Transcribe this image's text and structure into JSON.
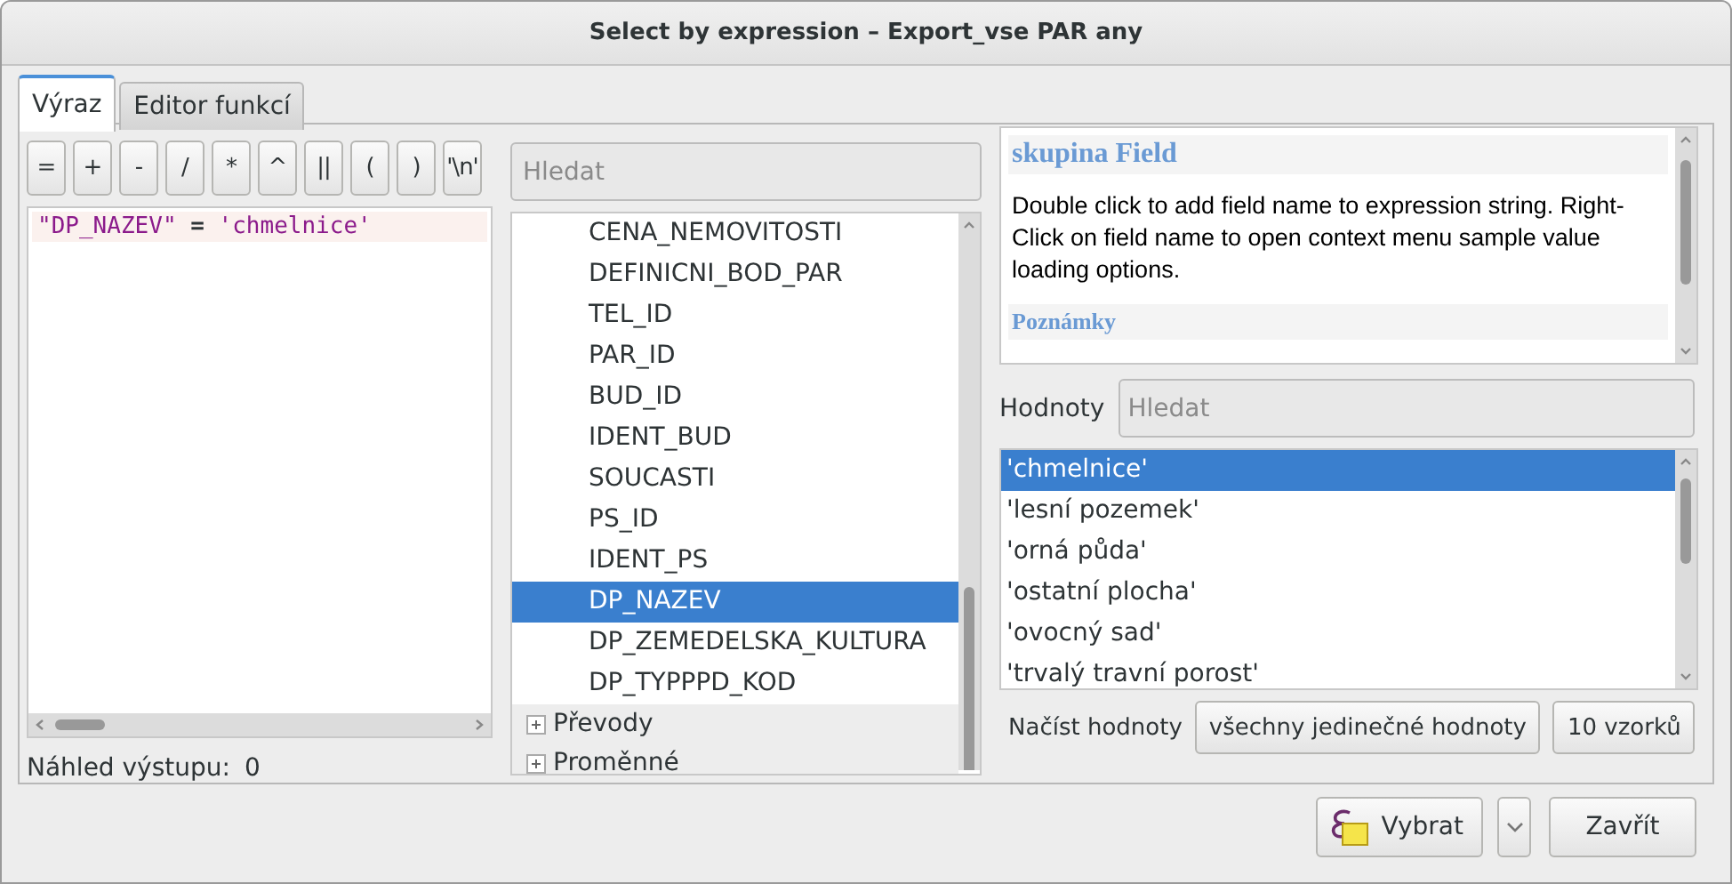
{
  "window": {
    "title": "Select by expression – Export_vse PAR any"
  },
  "tabs": [
    {
      "label": "Výraz",
      "selected": true
    },
    {
      "label": "Editor funkcí",
      "selected": false
    }
  ],
  "operators": [
    "=",
    "+",
    "-",
    "/",
    "*",
    "^",
    "||",
    "(",
    ")",
    "'\\n'"
  ],
  "expression": {
    "field": "\"DP_NAZEV\"",
    "operator": "=",
    "value": "'chmelnice'"
  },
  "output_preview": {
    "label": "Náhled výstupu:",
    "value": "0"
  },
  "tree": {
    "search_placeholder": "Hledat",
    "fields": [
      {
        "label": "CENA_NEMOVITOSTI",
        "selected": false
      },
      {
        "label": "DEFINICNI_BOD_PAR",
        "selected": false
      },
      {
        "label": "TEL_ID",
        "selected": false
      },
      {
        "label": "PAR_ID",
        "selected": false
      },
      {
        "label": "BUD_ID",
        "selected": false
      },
      {
        "label": "IDENT_BUD",
        "selected": false
      },
      {
        "label": "SOUCASTI",
        "selected": false
      },
      {
        "label": "PS_ID",
        "selected": false
      },
      {
        "label": "IDENT_PS",
        "selected": false
      },
      {
        "label": "DP_NAZEV",
        "selected": true
      },
      {
        "label": "DP_ZEMEDELSKA_KULTURA",
        "selected": false
      },
      {
        "label": "DP_TYPPPD_KOD",
        "selected": false
      }
    ],
    "groups": [
      {
        "label": "Převody",
        "expanded": false
      },
      {
        "label": "Proměnné",
        "expanded": false
      }
    ]
  },
  "help": {
    "title": "skupina Field",
    "text": "Double click to add field name to expression string. Right-Click on field name to open context menu sample value loading options.",
    "notes_heading": "Poznámky"
  },
  "values": {
    "label": "Hodnoty",
    "search_placeholder": "Hledat",
    "items": [
      {
        "text": "'chmelnice'",
        "selected": true
      },
      {
        "text": "'lesní pozemek'",
        "selected": false
      },
      {
        "text": "'orná půda'",
        "selected": false
      },
      {
        "text": "'ostatní plocha'",
        "selected": false
      },
      {
        "text": "'ovocný sad'",
        "selected": false
      },
      {
        "text": "'trvalý travní porost'",
        "selected": false
      }
    ],
    "load_label": "Načíst hodnoty",
    "load_buttons": [
      "všechny jedinečné hodnoty",
      "10 vzorků"
    ]
  },
  "footer": {
    "select_button": "Vybrat",
    "close_button": "Zavřít"
  }
}
